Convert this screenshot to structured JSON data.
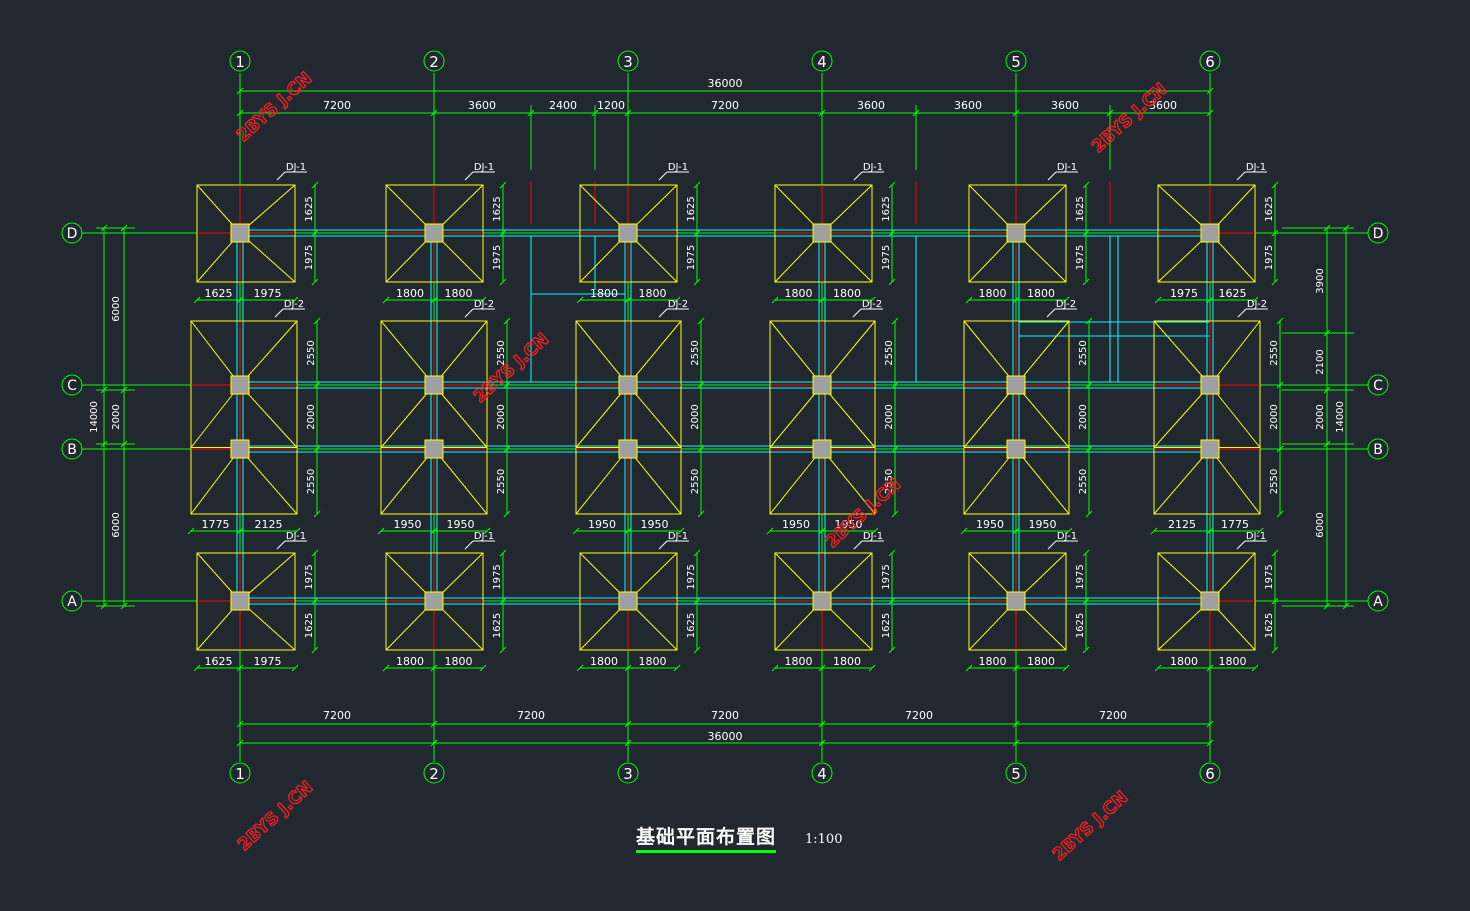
{
  "drawing": {
    "title": "基础平面布置图",
    "scale": "1:100",
    "watermark": "2BYS J.CN",
    "axes_x": [
      "1",
      "2",
      "3",
      "4",
      "5",
      "6"
    ],
    "axes_y": [
      "D",
      "C",
      "B",
      "A"
    ],
    "top_overall": "36000",
    "top_bays": [
      "7200",
      "3600",
      "2400",
      "1200",
      "7200",
      "3600",
      "3600",
      "3600",
      "3600"
    ],
    "bottom_bays": [
      "7200",
      "7200",
      "7200",
      "7200",
      "7200"
    ],
    "bottom_overall": "36000",
    "left_overall": "14000",
    "left_dims": [
      "6000",
      "2000",
      "6000"
    ],
    "right_overall": "14000",
    "right_dims": [
      "3900",
      "2100",
      "2000",
      "6000"
    ],
    "footing_dj1": "DJ-1",
    "footing_dj2": "DJ-2",
    "row_d_widths": [
      [
        "1625",
        "1975"
      ],
      [
        "1800",
        "1800"
      ],
      [
        "1800",
        "1800"
      ],
      [
        "1800",
        "1800"
      ],
      [
        "1800",
        "1800"
      ],
      [
        "1975",
        "1625"
      ]
    ],
    "row_d_vert": [
      "1625",
      "1975"
    ],
    "row_cb_widths": [
      [
        "1775",
        "2125"
      ],
      [
        "1950",
        "1950"
      ],
      [
        "1950",
        "1950"
      ],
      [
        "1950",
        "1950"
      ],
      [
        "1950",
        "1950"
      ],
      [
        "2125",
        "1775"
      ]
    ],
    "row_cb_vert": [
      "2550",
      "2000",
      "2550"
    ],
    "row_a_widths": [
      [
        "1625",
        "1975"
      ],
      [
        "1800",
        "1800"
      ],
      [
        "1800",
        "1800"
      ],
      [
        "1800",
        "1800"
      ],
      [
        "1800",
        "1800"
      ],
      [
        "1800",
        "1800"
      ]
    ],
    "row_a_vert": [
      "1975",
      "1625"
    ],
    "colors": {
      "background": "#212830",
      "axis": "#00ff00",
      "footing": "#ffff00",
      "beam": "#00ffff",
      "center": "#ff0000",
      "column": "#a0a0a0",
      "watermark": "#ff2020"
    }
  }
}
